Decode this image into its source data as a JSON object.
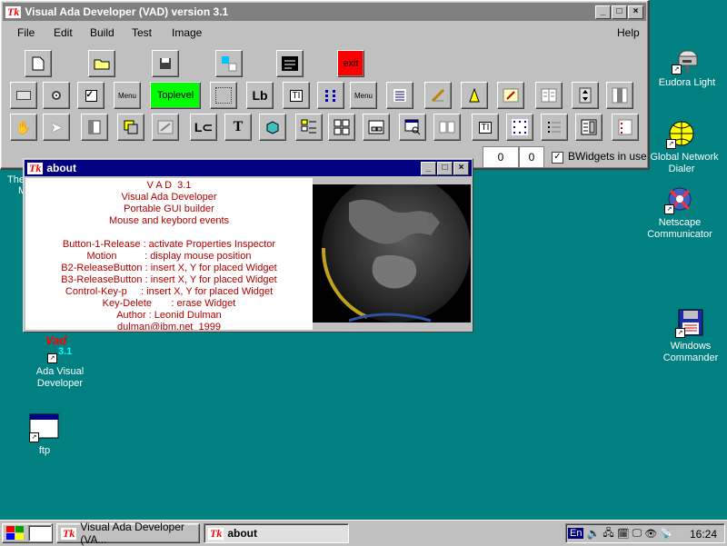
{
  "vad": {
    "title": "Visual Ada Developer (VAD) version 3.1",
    "logo": "Tk",
    "menu": [
      "File",
      "Edit",
      "Build",
      "Test",
      "Image",
      "Help"
    ],
    "toplevel_label": "Toplevel",
    "exit_label": "exit",
    "menu_icon_label": "Menu",
    "lb_label": "Lb",
    "ti_label": "TI",
    "t_label": "T",
    "spin_x": "0",
    "spin_y": "0",
    "bwidgets_label": "BWidgets in use",
    "bwidgets_checked": true
  },
  "about": {
    "title": "about",
    "logo": "Tk",
    "lines": [
      "V A D  3.1",
      "Visual Ada Developer",
      "Portable GUI builder",
      "Mouse and keybord events",
      "",
      "Button-1-Release : activate Properties Inspector",
      "Motion          : display mouse position",
      "B2-ReleaseButton : insert X, Y for placed Widget",
      "B3-ReleaseButton : insert X, Y for placed Widget",
      "Control-Key-p     : insert X, Y for placed Widget",
      "Key-Delete       : erase Widget",
      "Author : Leonid Dulman",
      "dulman@ibm.net  1999"
    ],
    "text_color": "#b00000"
  },
  "desktop": {
    "vad_icon_label": "Ada Visual Developer",
    "vad_icon_text": "Vad",
    "vad_icon_version": "3.1",
    "ftp_label": "ftp",
    "eudora_label": "Eudora Light",
    "global_label": "t Global Network Dialer",
    "netscape_label": "Netscape Communicator",
    "windows_commander_label": "Windows Commander",
    "partial_left": "The",
    "partial_left2": "M"
  },
  "taskbar": {
    "start_text": "",
    "buttons": [
      {
        "logo": "Tk",
        "label": "Visual Ada Developer (VA..."
      },
      {
        "logo": "Tk",
        "label": "about"
      }
    ],
    "lang": "En",
    "clock": "16:24"
  },
  "colors": {
    "desktop": "#008080",
    "active_title": "#000080",
    "toplevel": "#00ff00",
    "exit": "#ff0000"
  }
}
